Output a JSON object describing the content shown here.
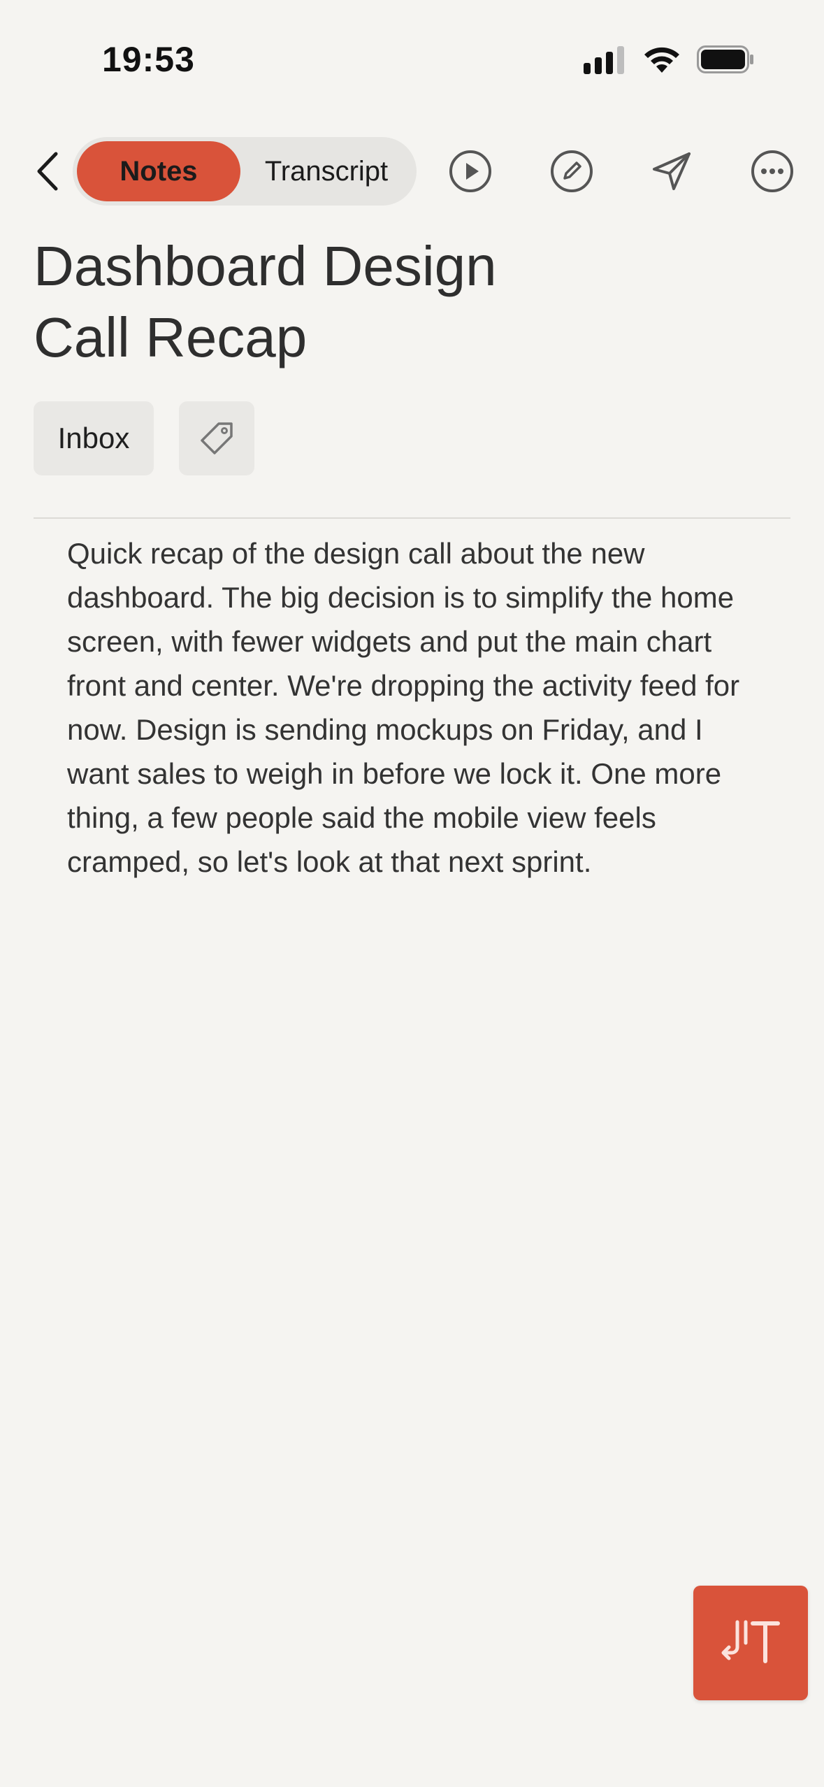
{
  "status_bar": {
    "time": "19:53",
    "icons": [
      "cellular-signal-icon",
      "wifi-icon",
      "battery-icon"
    ]
  },
  "toolbar": {
    "tabs": [
      {
        "label": "Notes",
        "active": true
      },
      {
        "label": "Transcript",
        "active": false
      }
    ],
    "icons": [
      "back-chevron-icon",
      "play-icon",
      "edit-icon",
      "send-icon",
      "more-icon"
    ]
  },
  "note": {
    "title_line1": "Dashboard Design",
    "title_line2": "Call Recap",
    "folder": "Inbox",
    "body": "Quick recap of the design call about the new dashboard. The big decision is to simplify the home screen, with fewer widgets and put the main chart front and center. We're dropping the activity feed for now. Design is sending mockups on Friday, and I want sales to weigh in before we lock it. One more thing, a few people said the mobile view feels cramped, so let's look at that next sprint."
  },
  "colors": {
    "accent": "#d9533a",
    "background": "#f5f4f1",
    "chip": "#e9e8e5"
  }
}
